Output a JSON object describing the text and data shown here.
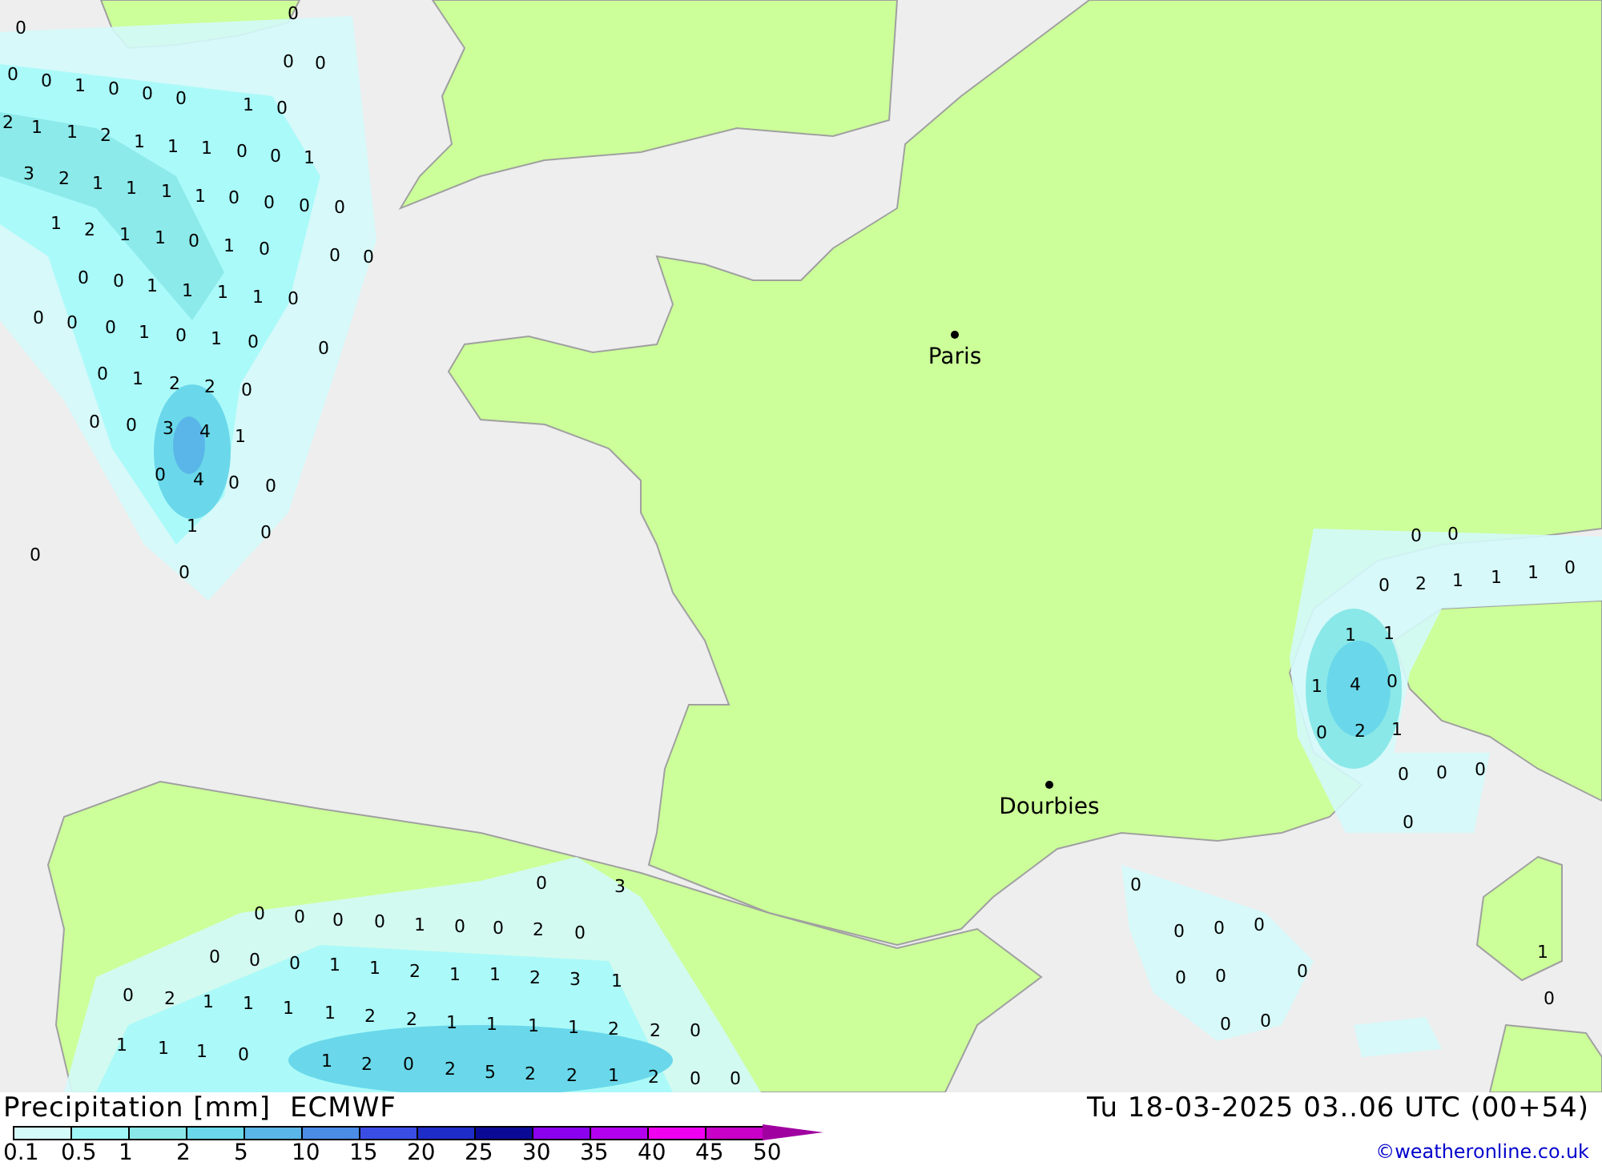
{
  "map": {
    "cities": [
      {
        "name": "Paris"
      },
      {
        "name": "Dourbies"
      }
    ],
    "precip_values": [
      "0",
      "0",
      "0",
      "0",
      "0",
      "0",
      "1",
      "0",
      "0",
      "0",
      "1",
      "0",
      "2",
      "1",
      "1",
      "2",
      "1",
      "1",
      "1",
      "0",
      "0",
      "1",
      "3",
      "2",
      "1",
      "1",
      "1",
      "1",
      "0",
      "0",
      "0",
      "0",
      "1",
      "2",
      "1",
      "1",
      "0",
      "1",
      "0",
      "0",
      "0",
      "0",
      "0",
      "1",
      "1",
      "1",
      "1",
      "0",
      "0",
      "0",
      "0",
      "1",
      "0",
      "1",
      "0",
      "0",
      "0",
      "1",
      "2",
      "2",
      "0",
      "0",
      "0",
      "3",
      "4",
      "1",
      "0",
      "4",
      "0",
      "0",
      "1",
      "0",
      "0",
      "0",
      "0",
      "0",
      "0",
      "2",
      "1",
      "1",
      "1",
      "0",
      "1",
      "1",
      "1",
      "4",
      "0",
      "0",
      "2",
      "1",
      "0",
      "0",
      "0",
      "0",
      "0",
      "3",
      "0",
      "0",
      "0",
      "0",
      "1",
      "0",
      "0",
      "2",
      "0",
      "0",
      "0",
      "0",
      "1",
      "1",
      "2",
      "1",
      "1",
      "2",
      "3",
      "1",
      "0",
      "2",
      "1",
      "1",
      "1",
      "1",
      "2",
      "2",
      "1",
      "1",
      "1",
      "1",
      "2",
      "2",
      "0",
      "1",
      "1",
      "1",
      "0",
      "1",
      "2",
      "0",
      "2",
      "5",
      "2",
      "2",
      "1",
      "2",
      "0",
      "0",
      "0",
      "0",
      "0",
      "0",
      "0",
      "0",
      "0",
      "0",
      "0",
      "1",
      "0"
    ]
  },
  "footer": {
    "title": "Precipitation [mm]",
    "model": "ECMWF",
    "valid_time": "Tu 18-03-2025 03..06 UTC (00+54)",
    "legend": {
      "bins": [
        {
          "label": "0.1",
          "color": "#d4fafa"
        },
        {
          "label": "0.5",
          "color": "#a0f6f6"
        },
        {
          "label": "1",
          "color": "#8ae8e8"
        },
        {
          "label": "2",
          "color": "#6ad8ea"
        },
        {
          "label": "5",
          "color": "#5ab6e8"
        },
        {
          "label": "10",
          "color": "#4a8ce6"
        },
        {
          "label": "15",
          "color": "#3a4ee6"
        },
        {
          "label": "20",
          "color": "#1e2cc8"
        },
        {
          "label": "25",
          "color": "#0a0a96"
        },
        {
          "label": "30",
          "color": "#8c00f0"
        },
        {
          "label": "35",
          "color": "#b400f0"
        },
        {
          "label": "40",
          "color": "#f000f0"
        },
        {
          "label": "45",
          "color": "#c800c8"
        }
      ],
      "end_label": "50"
    },
    "credit": "©weatheronline.co.uk"
  }
}
